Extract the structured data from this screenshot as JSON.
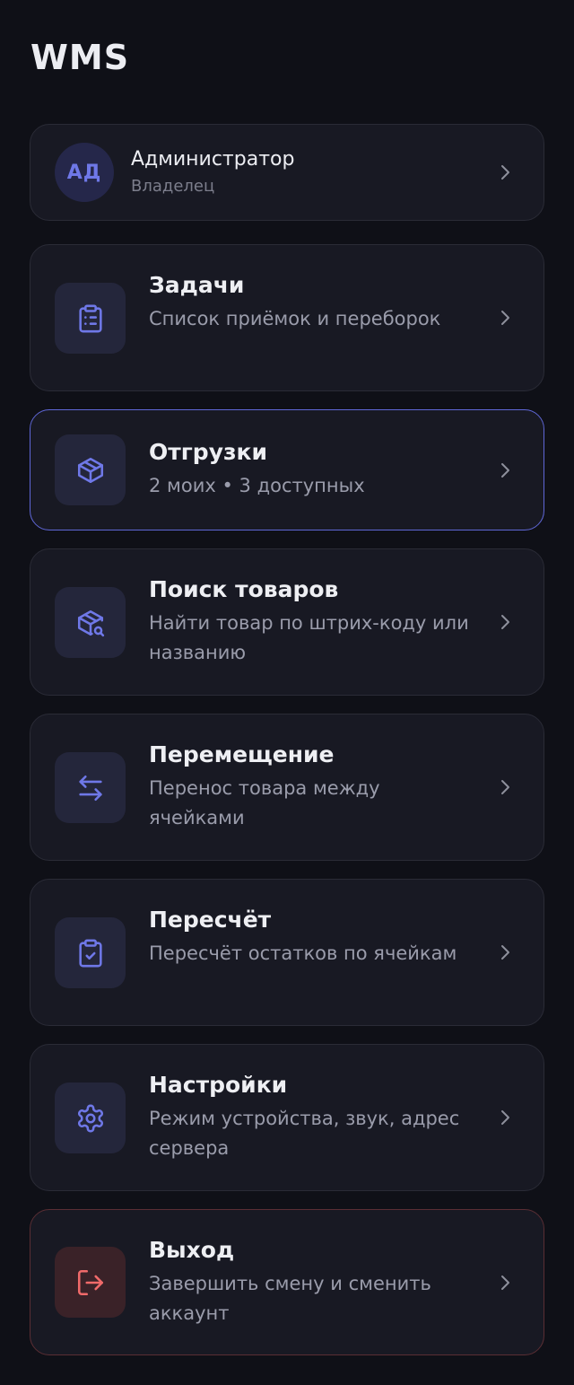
{
  "header": {
    "title": "WMS"
  },
  "profile": {
    "initials": "АД",
    "name": "Администратор",
    "role": "Владелец"
  },
  "menu": [
    {
      "title": "Задачи",
      "subtitle": "Список приёмок и переборок",
      "icon": "clipboard-list-icon"
    },
    {
      "title": "Отгрузки",
      "subtitle": "2 моих • 3 доступных",
      "icon": "package-icon"
    },
    {
      "title": "Поиск товаров",
      "subtitle": "Найти товар по штрих-коду или названию",
      "icon": "package-search-icon"
    },
    {
      "title": "Перемещение",
      "subtitle": "Перенос товара между ячейками",
      "icon": "arrows-left-right-icon"
    },
    {
      "title": "Пересчёт",
      "subtitle": "Пересчёт остатков по ячейкам",
      "icon": "clipboard-check-icon"
    },
    {
      "title": "Настройки",
      "subtitle": "Режим устройства, звук, адрес сервера",
      "icon": "gear-icon"
    },
    {
      "title": "Выход",
      "subtitle": "Завершить смену и сменить аккаунт",
      "icon": "logout-icon"
    }
  ],
  "colors": {
    "accent": "#6f78e8",
    "danger": "#f06a6a",
    "background": "#0f1017",
    "card": "#181923"
  }
}
